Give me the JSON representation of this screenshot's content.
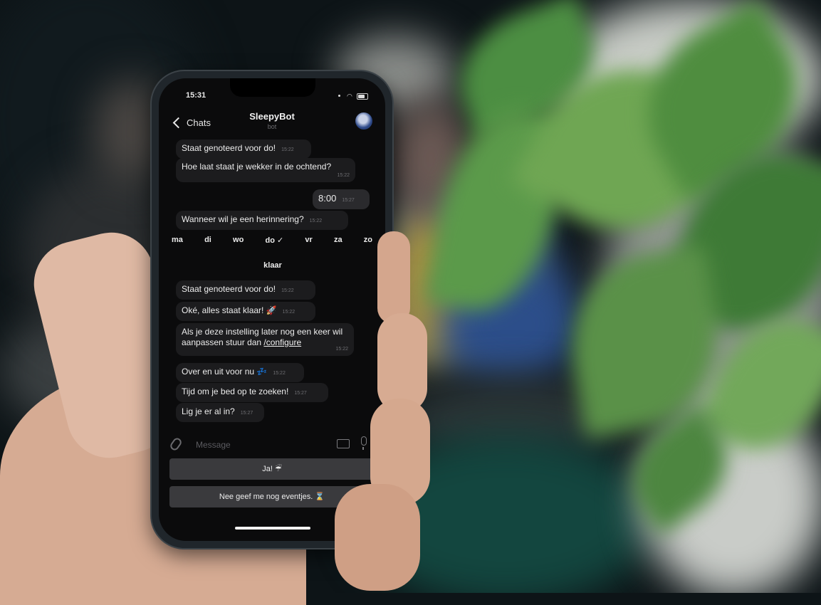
{
  "status_bar": {
    "time": "15:31"
  },
  "nav": {
    "back_label": "Chats",
    "title": "SleepyBot",
    "subtitle": "bot"
  },
  "messages": [
    {
      "text": "Staat genoteerd voor do!",
      "time": "15:22"
    },
    {
      "text": "Hoe laat staat je wekker in de ochtend?",
      "time": "15:22"
    },
    {
      "text": "8:00",
      "time": "15:27",
      "outgoing": true
    },
    {
      "text": "Wanneer wil je een herinnering?",
      "time": "15:22"
    },
    {
      "text": "Staat genoteerd voor do!",
      "time": "15:22"
    },
    {
      "text": "Oké, alles staat klaar! 🚀",
      "time": "15:22"
    },
    {
      "text": "Als je deze instelling later nog een keer wil aanpassen stuur dan ",
      "command": "/configure",
      "time": "15:22"
    },
    {
      "text": "Over en uit voor nu 💤",
      "time": "15:22"
    },
    {
      "text": "Tijd om je bed op te zoeken!",
      "time": "15:27"
    },
    {
      "text": "Lig je er al in?",
      "time": "15:27"
    }
  ],
  "inline_keyboard": {
    "days": [
      "ma",
      "di",
      "wo",
      "do ✓",
      "vr",
      "za",
      "zo"
    ],
    "done": "klaar"
  },
  "input": {
    "placeholder": "Message"
  },
  "reply_keyboard": [
    "Ja! ☔",
    "Nee geef me nog eventjes. ⌛"
  ],
  "icons": [
    "chevron-left-icon",
    "avatar-icon",
    "paperclip-icon",
    "keyboard-icon",
    "microphone-icon",
    "wifi-icon",
    "battery-icon"
  ]
}
